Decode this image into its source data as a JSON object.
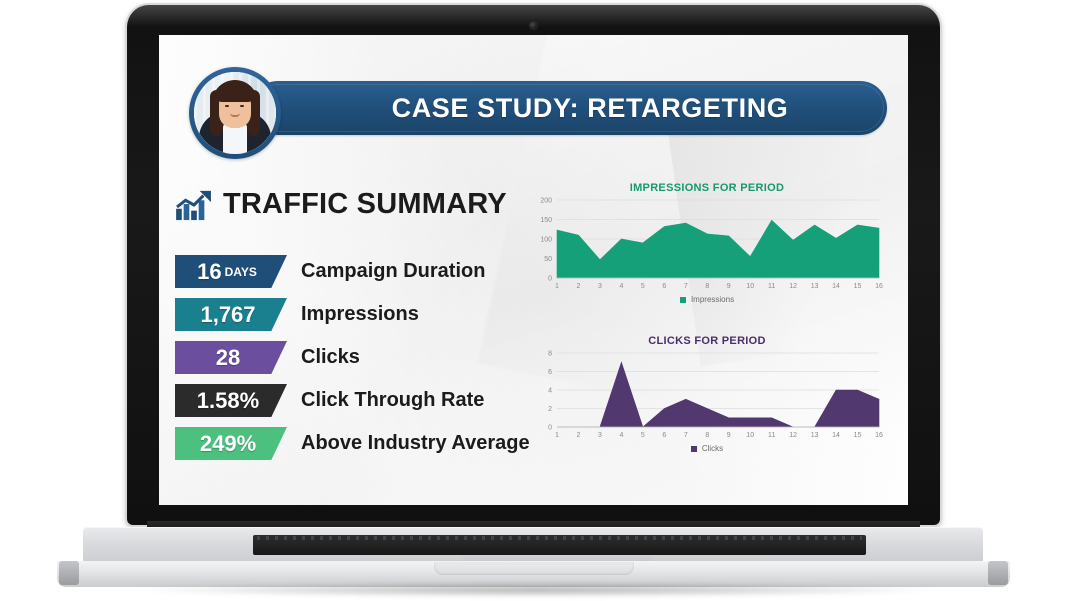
{
  "slide": {
    "header": {
      "title": "CASE STUDY: RETARGETING",
      "avatar_alt": "presenter-portrait"
    },
    "summary": {
      "icon": "bar-chart-growth-icon",
      "title": "TRAFFIC SUMMARY"
    },
    "stats": [
      {
        "value": "16",
        "unit": "DAYS",
        "label": "Campaign Duration",
        "color": "#1f4e79"
      },
      {
        "value": "1,767",
        "unit": "",
        "label": "Impressions",
        "color": "#1a7f8e"
      },
      {
        "value": "28",
        "unit": "",
        "label": "Clicks",
        "color": "#6b4f9e"
      },
      {
        "value": "1.58%",
        "unit": "",
        "label": "Click Through Rate",
        "color": "#2b2b2b"
      },
      {
        "value": "249%",
        "unit": "",
        "label": "Above Industry Average",
        "color": "#4cc17f"
      }
    ]
  },
  "chart_data": [
    {
      "type": "area",
      "title": "IMPRESSIONS FOR PERIOD",
      "xlabel": "",
      "ylabel": "",
      "color": "#16a07a",
      "legend": [
        "Impressions"
      ],
      "legend_position": "bottom",
      "grid": true,
      "x": [
        1,
        2,
        3,
        4,
        5,
        6,
        7,
        8,
        9,
        10,
        11,
        12,
        13,
        14,
        15,
        16
      ],
      "categories": [
        "1",
        "2",
        "3",
        "4",
        "5",
        "6",
        "7",
        "8",
        "9",
        "10",
        "11",
        "12",
        "13",
        "14",
        "15",
        "16"
      ],
      "yticks": [
        0,
        50,
        100,
        150,
        200
      ],
      "ylim": [
        0,
        200
      ],
      "series": [
        {
          "name": "Impressions",
          "values": [
            123,
            110,
            47,
            100,
            90,
            132,
            141,
            113,
            108,
            55,
            148,
            97,
            136,
            102,
            136,
            128
          ]
        }
      ]
    },
    {
      "type": "area",
      "title": "CLICKS FOR PERIOD",
      "xlabel": "",
      "ylabel": "",
      "color": "#51386e",
      "legend": [
        "Clicks"
      ],
      "legend_position": "bottom",
      "grid": true,
      "x": [
        1,
        2,
        3,
        4,
        5,
        6,
        7,
        8,
        9,
        10,
        11,
        12,
        13,
        14,
        15,
        16
      ],
      "categories": [
        "1",
        "2",
        "3",
        "4",
        "5",
        "6",
        "7",
        "8",
        "9",
        "10",
        "11",
        "12",
        "13",
        "14",
        "15",
        "16"
      ],
      "yticks": [
        0,
        2,
        4,
        6,
        8
      ],
      "ylim": [
        0,
        8
      ],
      "series": [
        {
          "name": "Clicks",
          "values": [
            0,
            0,
            0,
            7,
            0,
            2,
            3,
            2,
            1,
            1,
            1,
            0,
            0,
            4,
            4,
            3
          ]
        }
      ]
    }
  ]
}
